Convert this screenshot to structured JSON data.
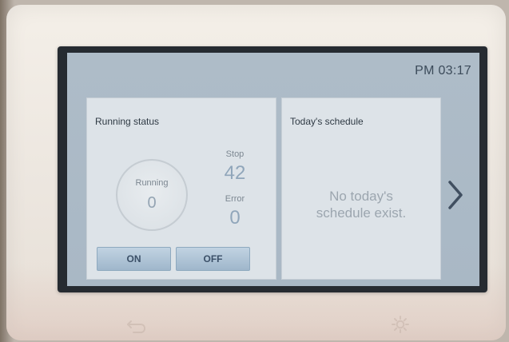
{
  "status_bar": {
    "time": "PM 03:17"
  },
  "running_status": {
    "title": "Running status",
    "running_label": "Running",
    "running_value": "0",
    "stop_label": "Stop",
    "stop_value": "42",
    "error_label": "Error",
    "error_value": "0",
    "on_label": "ON",
    "off_label": "OFF"
  },
  "schedule": {
    "title": "Today's schedule",
    "empty_message": "No today's schedule exist."
  },
  "icons": {
    "next": "chevron-right-icon",
    "back": "back-arrow-icon",
    "settings": "settings-icon"
  },
  "colors": {
    "screen_background": "#aebcc8",
    "panel_background": "#dde3e8",
    "accent": "#90a6ba",
    "button": "#a9c0d3"
  }
}
